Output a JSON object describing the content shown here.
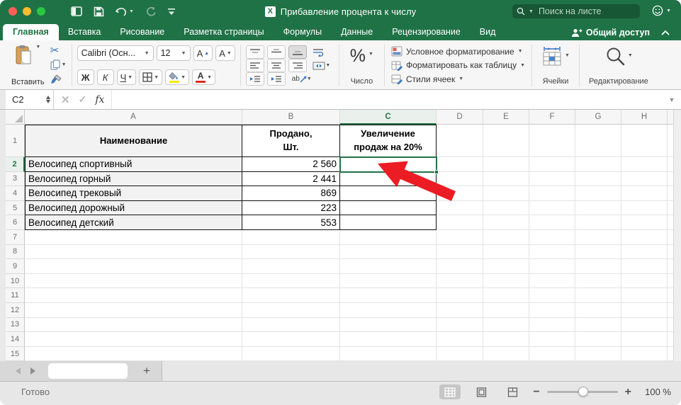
{
  "titlebar": {
    "title": "Прибавление процента к числу",
    "search_placeholder": "Поиск на листе"
  },
  "tabs": {
    "items": [
      "Главная",
      "Вставка",
      "Рисование",
      "Разметка страницы",
      "Формулы",
      "Данные",
      "Рецензирование",
      "Вид"
    ],
    "active": "Главная",
    "share_label": "Общий доступ"
  },
  "ribbon": {
    "paste_label": "Вставить",
    "font_name": "Calibri (Осн...",
    "font_size": "12",
    "bold_label": "Ж",
    "italic_label": "К",
    "underline_label": "Ч",
    "percent_label": "%",
    "number_group_label": "Число",
    "conditional_formatting_label": "Условное форматирование",
    "format_as_table_label": "Форматировать как таблицу",
    "cell_styles_label": "Стили ячеек",
    "cells_group_label": "Ячейки",
    "editing_group_label": "Редактирование"
  },
  "formula_bar": {
    "cell_reference": "C2",
    "function_label": "fx",
    "value": ""
  },
  "sheet": {
    "columns": [
      "A",
      "B",
      "C",
      "D",
      "E",
      "F",
      "G",
      "H"
    ],
    "visible_rows": 15,
    "selected_cell": "C2",
    "selected_column": "C",
    "selected_row": "2",
    "cells": {
      "A1": "Наименование",
      "B1": "Продано,\nШт.",
      "C1": "Увеличение\nпродаж на 20%",
      "A2": "Велосипед спортивный",
      "B2": "2 560",
      "A3": "Велосипед горный",
      "B3": "2 441",
      "A4": "Велосипед трековый",
      "B4": "869",
      "A5": "Велосипед дорожный",
      "B5": "223",
      "A6": "Велосипед детский",
      "B6": "553"
    }
  },
  "sheet_tabs": {
    "add_label": "+"
  },
  "status_bar": {
    "status": "Готово",
    "zoom_level": "100 %"
  },
  "colors": {
    "excel_green": "#1F7246",
    "selection_green": "#217346",
    "arrow_red": "#EC1C24"
  }
}
